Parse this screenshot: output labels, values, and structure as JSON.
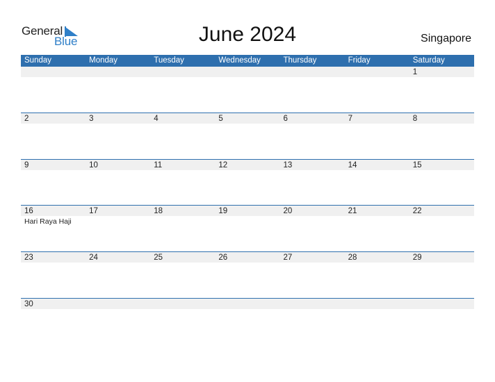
{
  "brand": {
    "line1": "General",
    "line2": "Blue",
    "accent": "#2f7fc8"
  },
  "title": "June 2024",
  "country": "Singapore",
  "colors": {
    "header_bg": "#2e6fae",
    "date_bar": "#f0f0f0"
  },
  "weekdays": [
    "Sunday",
    "Monday",
    "Tuesday",
    "Wednesday",
    "Thursday",
    "Friday",
    "Saturday"
  ],
  "weeks": [
    {
      "days": [
        {
          "num": "",
          "event": ""
        },
        {
          "num": "",
          "event": ""
        },
        {
          "num": "",
          "event": ""
        },
        {
          "num": "",
          "event": ""
        },
        {
          "num": "",
          "event": ""
        },
        {
          "num": "",
          "event": ""
        },
        {
          "num": "1",
          "event": ""
        }
      ]
    },
    {
      "days": [
        {
          "num": "2",
          "event": ""
        },
        {
          "num": "3",
          "event": ""
        },
        {
          "num": "4",
          "event": ""
        },
        {
          "num": "5",
          "event": ""
        },
        {
          "num": "6",
          "event": ""
        },
        {
          "num": "7",
          "event": ""
        },
        {
          "num": "8",
          "event": ""
        }
      ]
    },
    {
      "days": [
        {
          "num": "9",
          "event": ""
        },
        {
          "num": "10",
          "event": ""
        },
        {
          "num": "11",
          "event": ""
        },
        {
          "num": "12",
          "event": ""
        },
        {
          "num": "13",
          "event": ""
        },
        {
          "num": "14",
          "event": ""
        },
        {
          "num": "15",
          "event": ""
        }
      ]
    },
    {
      "days": [
        {
          "num": "16",
          "event": "Hari Raya Haji"
        },
        {
          "num": "17",
          "event": ""
        },
        {
          "num": "18",
          "event": ""
        },
        {
          "num": "19",
          "event": ""
        },
        {
          "num": "20",
          "event": ""
        },
        {
          "num": "21",
          "event": ""
        },
        {
          "num": "22",
          "event": ""
        }
      ]
    },
    {
      "days": [
        {
          "num": "23",
          "event": ""
        },
        {
          "num": "24",
          "event": ""
        },
        {
          "num": "25",
          "event": ""
        },
        {
          "num": "26",
          "event": ""
        },
        {
          "num": "27",
          "event": ""
        },
        {
          "num": "28",
          "event": ""
        },
        {
          "num": "29",
          "event": ""
        }
      ]
    },
    {
      "days": [
        {
          "num": "30",
          "event": ""
        },
        {
          "num": "",
          "event": ""
        },
        {
          "num": "",
          "event": ""
        },
        {
          "num": "",
          "event": ""
        },
        {
          "num": "",
          "event": ""
        },
        {
          "num": "",
          "event": ""
        },
        {
          "num": "",
          "event": ""
        }
      ]
    }
  ]
}
